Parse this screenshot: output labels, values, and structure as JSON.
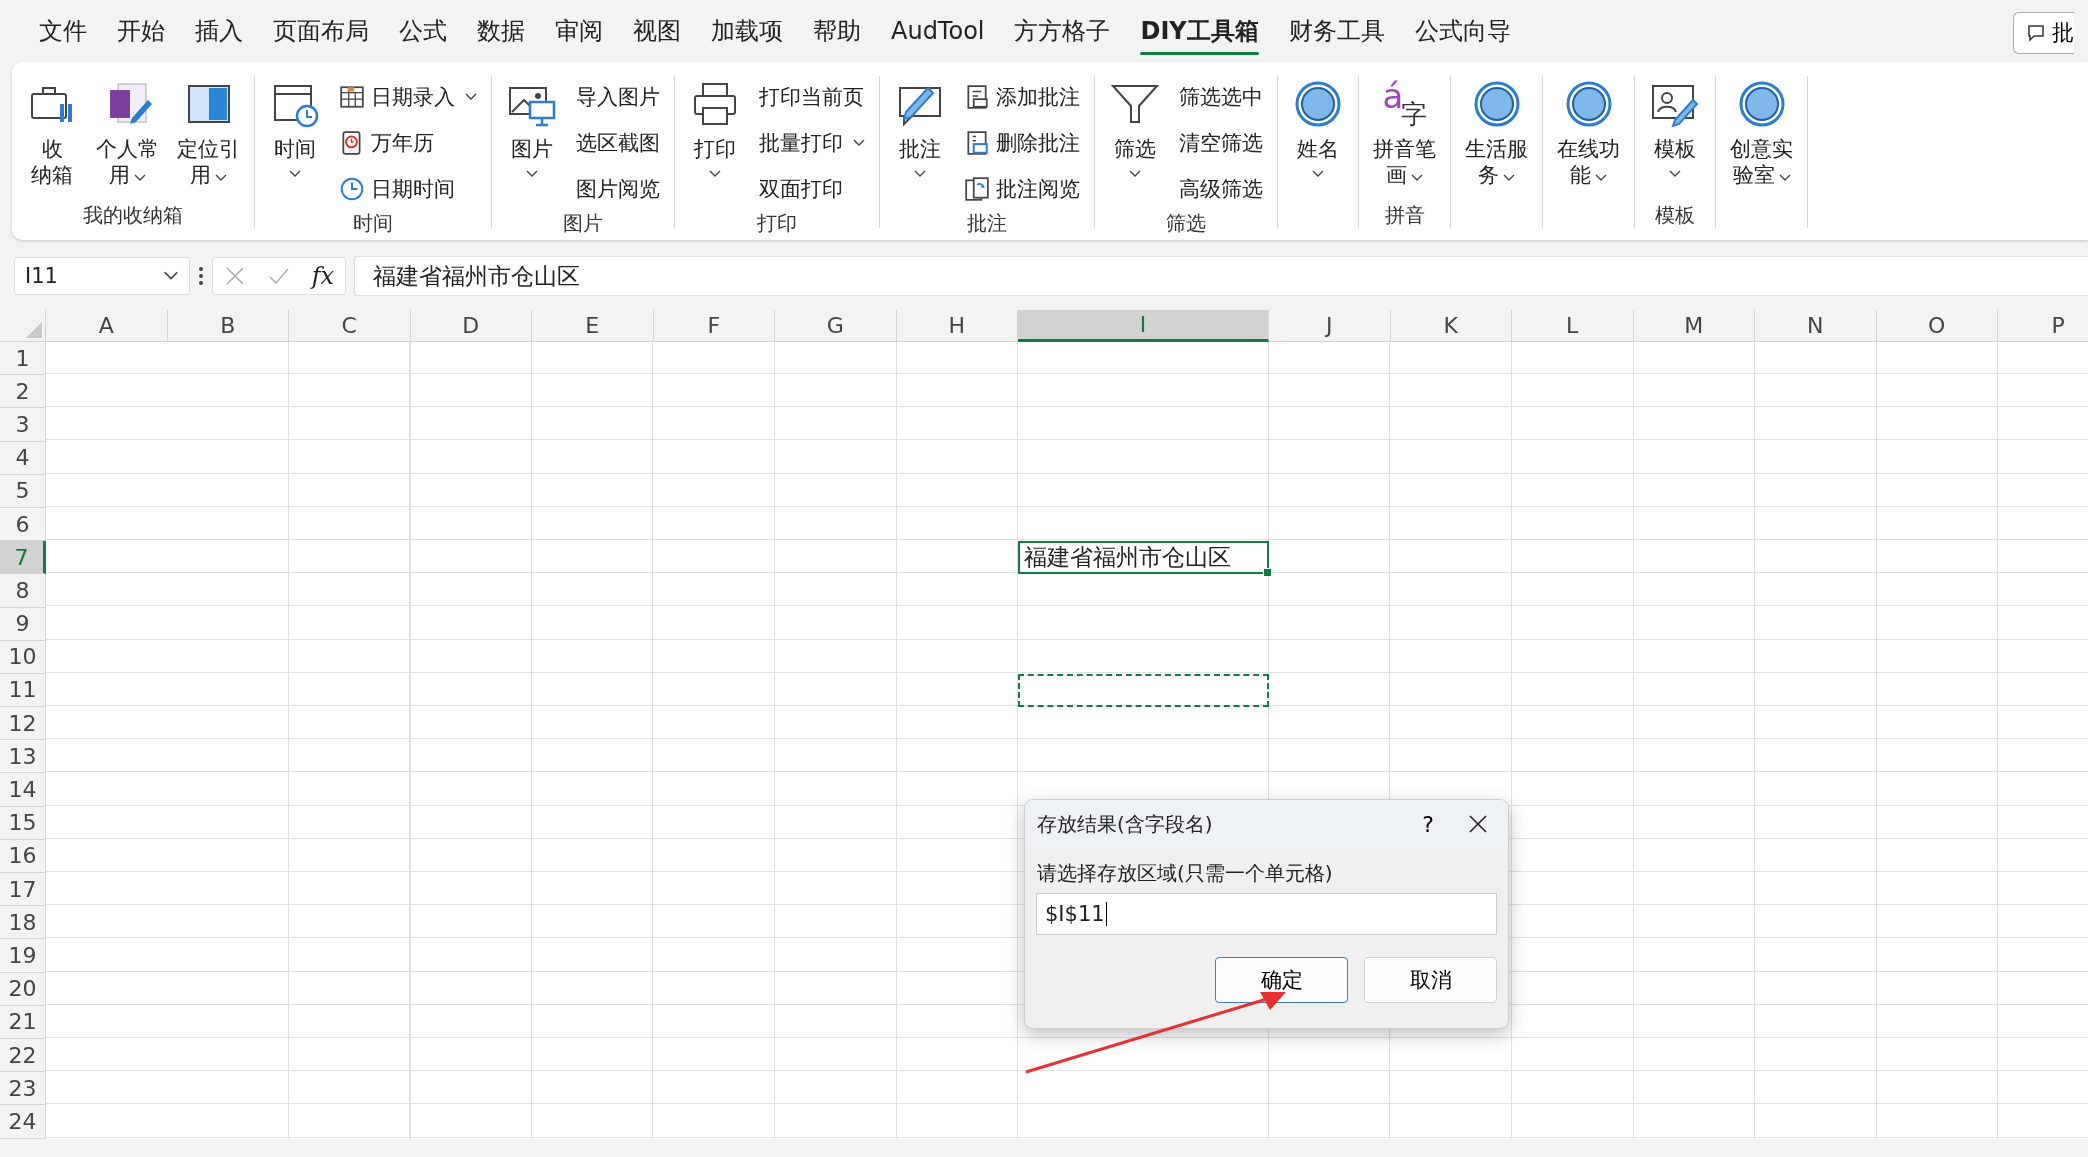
{
  "menu": {
    "tabs": [
      {
        "label": "文件",
        "selected": false
      },
      {
        "label": "开始",
        "selected": false
      },
      {
        "label": "插入",
        "selected": false
      },
      {
        "label": "页面布局",
        "selected": false
      },
      {
        "label": "公式",
        "selected": false
      },
      {
        "label": "数据",
        "selected": false
      },
      {
        "label": "审阅",
        "selected": false
      },
      {
        "label": "视图",
        "selected": false
      },
      {
        "label": "加载项",
        "selected": false
      },
      {
        "label": "帮助",
        "selected": false
      },
      {
        "label": "AudTool",
        "selected": false
      },
      {
        "label": "方方格子",
        "selected": false
      },
      {
        "label": "DIY工具箱",
        "selected": true
      },
      {
        "label": "财务工具",
        "selected": false
      },
      {
        "label": "公式向导",
        "selected": false
      }
    ],
    "comments_button": "批"
  },
  "ribbon": {
    "groups": [
      {
        "label": "我的收纳箱",
        "large": [
          {
            "lines": [
              "收",
              "纳箱"
            ],
            "dropdown": false
          },
          {
            "lines": [
              "个人常",
              "用"
            ],
            "dropdown": true
          },
          {
            "lines": [
              "定位引",
              "用"
            ],
            "dropdown": true
          }
        ]
      },
      {
        "label": "时间",
        "large": [
          {
            "lines": [
              "时间"
            ],
            "dropdown": true
          }
        ],
        "small": [
          {
            "label": "日期录入",
            "dropdown": true
          },
          {
            "label": "万年历",
            "dropdown": false
          },
          {
            "label": "日期时间",
            "dropdown": false
          }
        ]
      },
      {
        "label": "图片",
        "large": [
          {
            "lines": [
              "图片"
            ],
            "dropdown": true
          }
        ],
        "small": [
          {
            "label": "导入图片",
            "dropdown": false
          },
          {
            "label": "选区截图",
            "dropdown": false
          },
          {
            "label": "图片阅览",
            "dropdown": false
          }
        ]
      },
      {
        "label": "打印",
        "large": [
          {
            "lines": [
              "打印"
            ],
            "dropdown": true
          }
        ],
        "small": [
          {
            "label": "打印当前页",
            "dropdown": false
          },
          {
            "label": "批量打印",
            "dropdown": true
          },
          {
            "label": "双面打印",
            "dropdown": false
          }
        ]
      },
      {
        "label": "批注",
        "large": [
          {
            "lines": [
              "批注"
            ],
            "dropdown": true
          }
        ],
        "small": [
          {
            "label": "添加批注",
            "dropdown": false
          },
          {
            "label": "删除批注",
            "dropdown": false
          },
          {
            "label": "批注阅览",
            "dropdown": false
          }
        ]
      },
      {
        "label": "筛选",
        "large": [
          {
            "lines": [
              "筛选"
            ],
            "dropdown": true
          }
        ],
        "small": [
          {
            "label": "筛选选中",
            "dropdown": false
          },
          {
            "label": "清空筛选",
            "dropdown": false
          },
          {
            "label": "高级筛选",
            "dropdown": false
          }
        ]
      },
      {
        "large": [
          {
            "lines": [
              "姓名"
            ],
            "dropdown": true
          }
        ]
      },
      {
        "label": "拼音",
        "large": [
          {
            "lines": [
              "拼音笔",
              "画"
            ],
            "dropdown": true,
            "icon_letters": [
              "á",
              "字"
            ]
          }
        ]
      },
      {
        "large": [
          {
            "lines": [
              "生活服",
              "务"
            ],
            "dropdown": true
          }
        ]
      },
      {
        "large": [
          {
            "lines": [
              "在线功",
              "能"
            ],
            "dropdown": true
          }
        ]
      },
      {
        "label": "模板",
        "large": [
          {
            "lines": [
              "模板"
            ],
            "dropdown": true
          }
        ]
      },
      {
        "large": [
          {
            "lines": [
              "创意实",
              "验室"
            ],
            "dropdown": true
          }
        ]
      }
    ]
  },
  "formula_bar": {
    "name_box": "I11",
    "fx": "fx",
    "formula": "福建省福州市仓山区"
  },
  "grid": {
    "columns": [
      {
        "label": "A",
        "selected": false
      },
      {
        "label": "B",
        "selected": false
      },
      {
        "label": "C",
        "selected": false
      },
      {
        "label": "D",
        "selected": false
      },
      {
        "label": "E",
        "selected": false
      },
      {
        "label": "F",
        "selected": false
      },
      {
        "label": "G",
        "selected": false
      },
      {
        "label": "H",
        "selected": false
      },
      {
        "label": "I",
        "selected": true
      },
      {
        "label": "J",
        "selected": false
      },
      {
        "label": "K",
        "selected": false
      },
      {
        "label": "L",
        "selected": false
      },
      {
        "label": "M",
        "selected": false
      },
      {
        "label": "N",
        "selected": false
      },
      {
        "label": "O",
        "selected": false
      },
      {
        "label": "P",
        "selected": false
      }
    ],
    "rows": [
      {
        "label": "1",
        "selected": false,
        "marquee": false
      },
      {
        "label": "2",
        "selected": false,
        "marquee": false
      },
      {
        "label": "3",
        "selected": false,
        "marquee": false
      },
      {
        "label": "4",
        "selected": false,
        "marquee": false
      },
      {
        "label": "5",
        "selected": false,
        "marquee": false
      },
      {
        "label": "6",
        "selected": false,
        "marquee": false
      },
      {
        "label": "7",
        "selected": true,
        "marquee": false,
        "value": "福建省福州市仓山区"
      },
      {
        "label": "8",
        "selected": false,
        "marquee": false
      },
      {
        "label": "9",
        "selected": false,
        "marquee": false
      },
      {
        "label": "10",
        "selected": false,
        "marquee": false
      },
      {
        "label": "11",
        "selected": false,
        "marquee": true
      },
      {
        "label": "12",
        "selected": false,
        "marquee": false
      },
      {
        "label": "13",
        "selected": false,
        "marquee": false
      },
      {
        "label": "14",
        "selected": false,
        "marquee": false
      },
      {
        "label": "15",
        "selected": false,
        "marquee": false
      },
      {
        "label": "16",
        "selected": false,
        "marquee": false
      },
      {
        "label": "17",
        "selected": false,
        "marquee": false
      },
      {
        "label": "18",
        "selected": false,
        "marquee": false
      },
      {
        "label": "19",
        "selected": false,
        "marquee": false
      },
      {
        "label": "20",
        "selected": false,
        "marquee": false
      },
      {
        "label": "21",
        "selected": false,
        "marquee": false
      },
      {
        "label": "22",
        "selected": false,
        "marquee": false
      },
      {
        "label": "23",
        "selected": false,
        "marquee": false
      },
      {
        "label": "24",
        "selected": false,
        "marquee": false
      }
    ]
  },
  "dialog": {
    "title": "存放结果(含字段名)",
    "help": "?",
    "label": "请选择存放区域(只需一个单元格)",
    "value": "$I$11",
    "buttons": [
      {
        "label": "确定",
        "kind": "default"
      },
      {
        "label": "取消",
        "kind": "normal"
      }
    ]
  },
  "annotation": {
    "kind": "arrow"
  }
}
